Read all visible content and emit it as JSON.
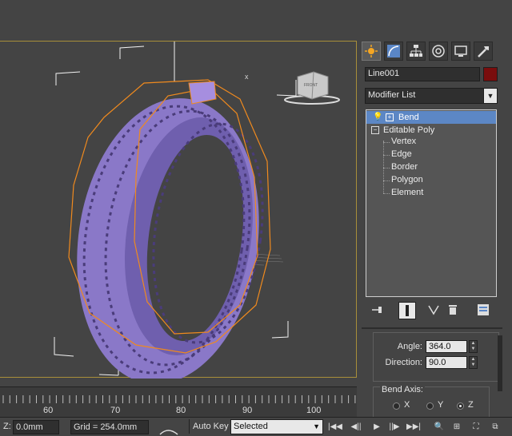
{
  "command_panel": {
    "tabs": [
      {
        "icon": "create-icon",
        "active": true
      },
      {
        "icon": "modify-icon",
        "active": false
      },
      {
        "icon": "hierarchy-icon",
        "active": false
      },
      {
        "icon": "motion-icon",
        "active": false
      },
      {
        "icon": "display-icon",
        "active": false
      },
      {
        "icon": "utilities-icon",
        "active": false
      }
    ],
    "object_name": "Line001",
    "object_color": "#7a0d0d",
    "modifier_list": "Modifier List",
    "stack": {
      "bend": "Bend",
      "editable_poly": "Editable Poly",
      "sub_objects": [
        "Vertex",
        "Edge",
        "Border",
        "Polygon",
        "Element"
      ]
    },
    "params": {
      "angle_label": "Angle:",
      "angle_value": "364.0",
      "direction_label": "Direction:",
      "direction_value": "90.0",
      "bend_axis_label": "Bend Axis:",
      "axes": [
        {
          "label": "X",
          "selected": false
        },
        {
          "label": "Y",
          "selected": false
        },
        {
          "label": "Z",
          "selected": true
        }
      ]
    }
  },
  "timeline": {
    "ticks": [
      "60",
      "70",
      "80",
      "90",
      "100"
    ]
  },
  "status_bar": {
    "z_label": "Z:",
    "z_value": "0.0mm",
    "grid": "Grid = 254.0mm",
    "auto_key": "Auto Key",
    "selected": "Selected"
  },
  "colors": {
    "tire": "#8a78c8",
    "selection": "#f08a1e",
    "stack_highlight": "#5c87c5"
  }
}
